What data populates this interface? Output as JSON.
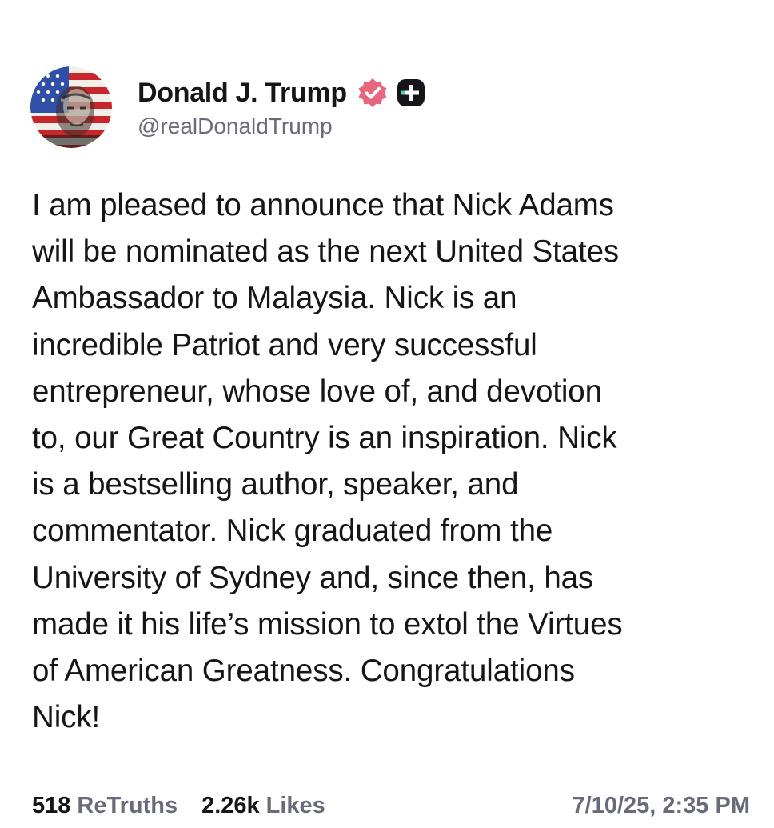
{
  "author": {
    "display_name": "Donald J. Trump",
    "handle": "@realDonaldTrump",
    "avatar_icon": "avatar-flag-portrait-icon",
    "verified_icon": "verified-badge-icon",
    "plus_icon": "truth-plus-badge-icon"
  },
  "post": {
    "text": "I am pleased to announce that Nick Adams\nwill be nominated as the next United States\nAmbassador to Malaysia. Nick is an\nincredible Patriot and very successful\nentrepreneur, whose love of, and devotion\nto, our Great Country is an inspiration. Nick\nis a bestselling author, speaker, and\ncommentator. Nick graduated from the\nUniversity of Sydney and, since then, has\nmade it his life’s mission to extol the Virtues\nof American Greatness. Congratulations\nNick!"
  },
  "stats": {
    "retruths_count": "518",
    "retruths_label": "ReTruths",
    "likes_count": "2.26k",
    "likes_label": "Likes",
    "timestamp": "7/10/25, 2:35 PM"
  },
  "colors": {
    "verified_badge": "#e8677e",
    "plus_badge": "#16161a",
    "text_primary": "#16161a",
    "text_secondary": "#6a6b7a"
  }
}
